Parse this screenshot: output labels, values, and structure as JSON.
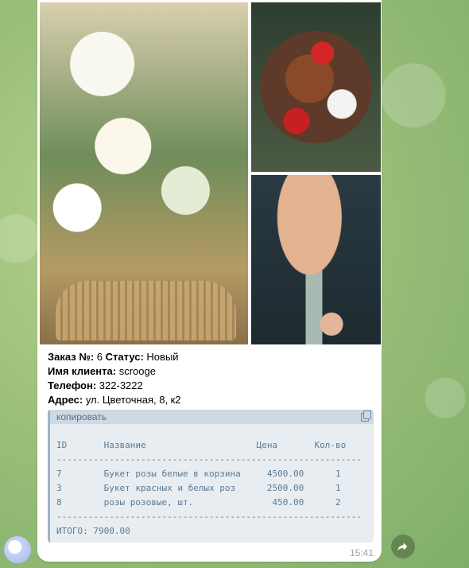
{
  "order": {
    "number_label": "Заказ №:",
    "number": "6",
    "status_label": "Статус:",
    "status": "Новый",
    "client_label": "Имя клиента:",
    "client": "scrooge",
    "phone_label": "Телефон:",
    "phone": "322-3222",
    "address_label": "Адрес:",
    "address": "ул. Цветочная, 8, к2"
  },
  "code": {
    "copy_label": "копировать",
    "table_text": "\nID       Название                     Цена       Кол-во\n----------------------------------------------------------\n7        Букет розы белые в корзина     4500.00      1\n3        Букет красных и белых роз      2500.00      1\n8        розы розовые, шт.               450.00      2\n----------------------------------------------------------\nИТОГО: 7900.00"
  },
  "message": {
    "time": "15:41"
  },
  "icons": {
    "copy": "copy-icon",
    "forward": "forward-arrow-icon"
  },
  "colors": {
    "bubble": "#ffffff",
    "code_bg": "#e8edf1",
    "code_text": "#5b7a96"
  }
}
